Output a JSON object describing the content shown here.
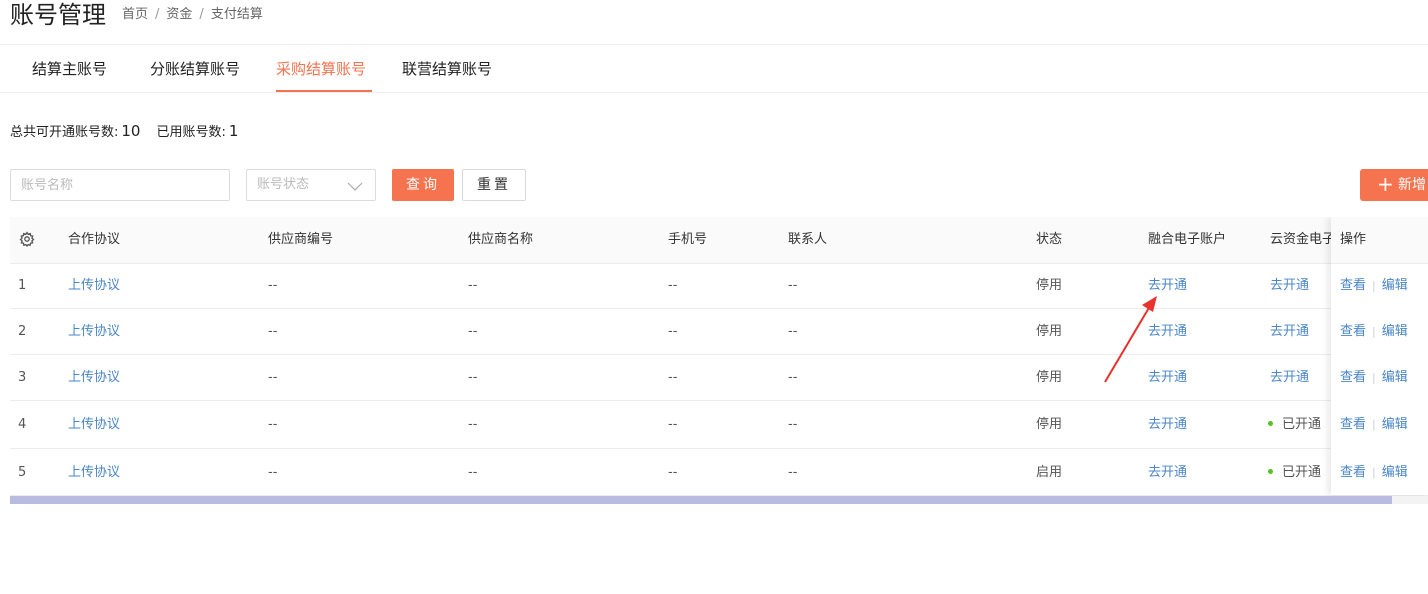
{
  "header": {
    "title": "账号管理",
    "breadcrumb": [
      "首页",
      "资金",
      "支付结算"
    ]
  },
  "tabs": [
    {
      "label": "结算主账号",
      "active": false
    },
    {
      "label": "分账结算账号",
      "active": false
    },
    {
      "label": "采购结算账号",
      "active": true
    },
    {
      "label": "联营结算账号",
      "active": false
    }
  ],
  "summary": {
    "total_label": "总共可开通账号数:",
    "total_value": "10",
    "used_label": "已用账号数:",
    "used_value": "1"
  },
  "filters": {
    "name_placeholder": "账号名称",
    "status_placeholder": "账号状态",
    "query_label": "查询",
    "reset_label": "重置",
    "add_label": "新增"
  },
  "table": {
    "columns": [
      "合作协议",
      "供应商编号",
      "供应商名称",
      "手机号",
      "联系人",
      "状态",
      "融合电子账户",
      "云资金电子",
      "操作"
    ],
    "rows": [
      {
        "index": "1",
        "agreement": "上传协议",
        "supplier_no": "--",
        "supplier_name": "--",
        "phone": "--",
        "contact": "--",
        "status": "停用",
        "fusion_account": "去开通",
        "cloud_account": "去开通",
        "cloud_opened": false
      },
      {
        "index": "2",
        "agreement": "上传协议",
        "supplier_no": "--",
        "supplier_name": "--",
        "phone": "--",
        "contact": "--",
        "status": "停用",
        "fusion_account": "去开通",
        "cloud_account": "去开通",
        "cloud_opened": false
      },
      {
        "index": "3",
        "agreement": "上传协议",
        "supplier_no": "--",
        "supplier_name": "--",
        "phone": "--",
        "contact": "--",
        "status": "停用",
        "fusion_account": "去开通",
        "cloud_account": "去开通",
        "cloud_opened": false
      },
      {
        "index": "4",
        "agreement": "上传协议",
        "supplier_no": "--",
        "supplier_name": "--",
        "phone": "--",
        "contact": "--",
        "status": "停用",
        "fusion_account": "去开通",
        "cloud_account": "已开通",
        "cloud_opened": true
      },
      {
        "index": "5",
        "agreement": "上传协议",
        "supplier_no": "--",
        "supplier_name": "--",
        "phone": "--",
        "contact": "--",
        "status": "启用",
        "fusion_account": "去开通",
        "cloud_account": "已开通",
        "cloud_opened": true
      }
    ],
    "actions": {
      "view": "查看",
      "edit": "编辑"
    }
  },
  "colors": {
    "accent": "#f5734f",
    "link": "#4a86c8",
    "success": "#52c41a",
    "annotation": "#e8322b"
  }
}
